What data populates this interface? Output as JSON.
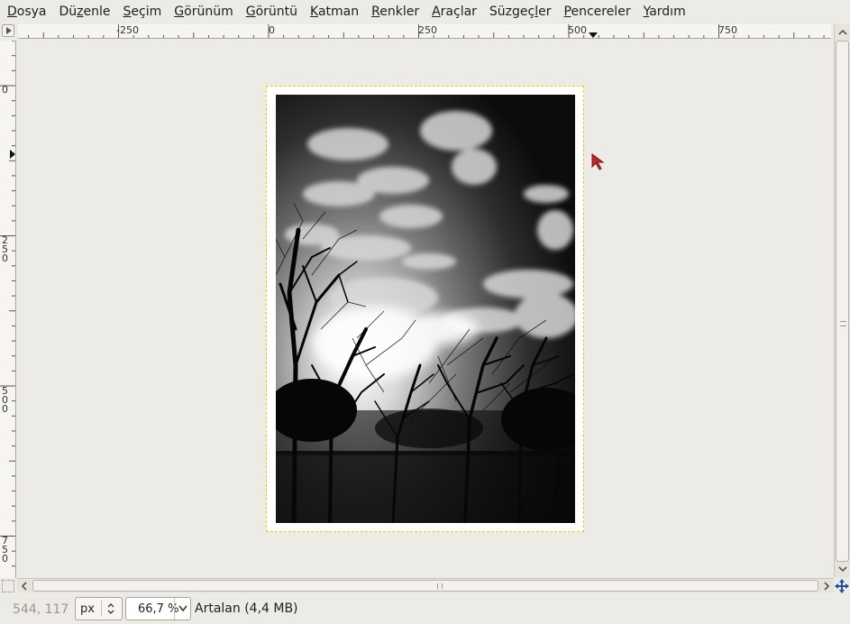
{
  "menubar": {
    "items": [
      {
        "pre": "",
        "ul": "D",
        "post": "osya"
      },
      {
        "pre": "Dü",
        "ul": "z",
        "post": "enle"
      },
      {
        "pre": "",
        "ul": "S",
        "post": "eçim"
      },
      {
        "pre": "",
        "ul": "G",
        "post": "örünüm"
      },
      {
        "pre": "",
        "ul": "G",
        "post": "örüntü"
      },
      {
        "pre": "",
        "ul": "K",
        "post": "atman"
      },
      {
        "pre": "",
        "ul": "R",
        "post": "enkler"
      },
      {
        "pre": "",
        "ul": "A",
        "post": "raçlar"
      },
      {
        "pre": "Süzgeç",
        "ul": "l",
        "post": "er"
      },
      {
        "pre": "",
        "ul": "P",
        "post": "encereler"
      },
      {
        "pre": "",
        "ul": "Y",
        "post": "ardım"
      }
    ]
  },
  "rulers": {
    "horizontal_labels": [
      "-250",
      "0",
      "250",
      "500",
      "750"
    ],
    "vertical_labels": [
      [
        "0"
      ],
      [
        "2",
        "5",
        "0"
      ],
      [
        "5",
        "0",
        "0"
      ],
      [
        "7",
        "5",
        "0"
      ]
    ]
  },
  "statusbar": {
    "coords": "544, 117",
    "unit": "px",
    "zoom": "66,7 %",
    "layer_info": "Artalan (4,4 MB)"
  },
  "icons": {
    "ruler_corner": "menu-arrow-icon",
    "quick_mask": "quick-mask-icon",
    "navigate": "navigate-icon",
    "pointer": "mouse-pointer-icon"
  }
}
